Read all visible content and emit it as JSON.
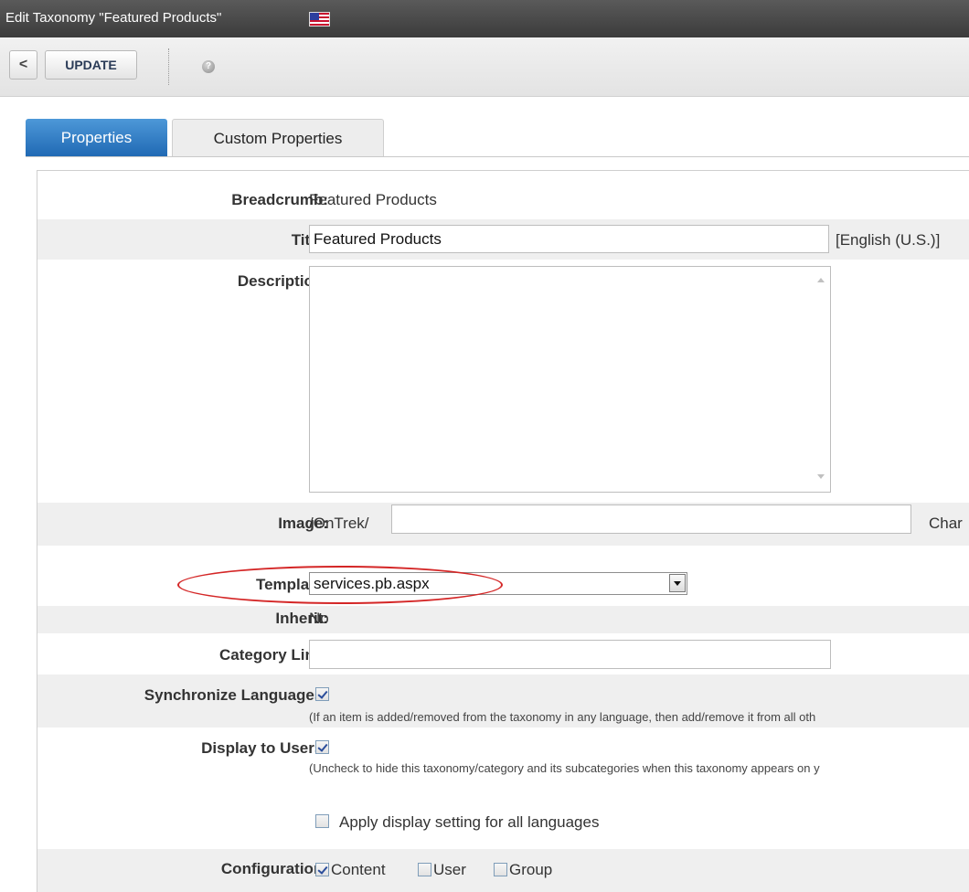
{
  "window": {
    "title": "Edit Taxonomy  \"Featured Products\""
  },
  "toolbar": {
    "back_label": "<",
    "update_label": "UPDATE",
    "help_label": "?"
  },
  "tabs": [
    {
      "label": "Properties",
      "active": true
    },
    {
      "label": "Custom Properties",
      "active": false
    }
  ],
  "form": {
    "breadcrumb": {
      "label": "Breadcrumb:",
      "value": "Featured Products"
    },
    "title": {
      "label": "Title:",
      "value": "Featured Products",
      "language": "[English (U.S.)]"
    },
    "description": {
      "label": "Description:",
      "value": ""
    },
    "image": {
      "label": "Image:",
      "prefix": "/OnTrek/",
      "value": "",
      "change_label": "Char"
    },
    "template": {
      "label": "Template:",
      "value": "services.pb.aspx"
    },
    "inherit": {
      "label": "Inherit:",
      "value": "No"
    },
    "category_link": {
      "label": "Category Link:",
      "value": ""
    },
    "sync_languages": {
      "label": "Synchronize Languages:",
      "checked": true,
      "help": "(If an item is added/removed from the taxonomy in any language, then add/remove it from all oth"
    },
    "display_to_users": {
      "label": "Display to Users:",
      "checked": true,
      "help": "(Uncheck to hide this taxonomy/category and its subcategories when this taxonomy appears on y",
      "apply_all_label": "Apply display setting for all languages",
      "apply_all_checked": false
    },
    "configuration": {
      "label": "Configuration:",
      "options": [
        {
          "label": "Content",
          "checked": true
        },
        {
          "label": "User",
          "checked": false
        },
        {
          "label": "Group",
          "checked": false
        }
      ]
    }
  },
  "colors": {
    "tab_active": "#1f68b3",
    "highlight_oval": "#d42626",
    "titlebar": "#3b3b3b"
  }
}
